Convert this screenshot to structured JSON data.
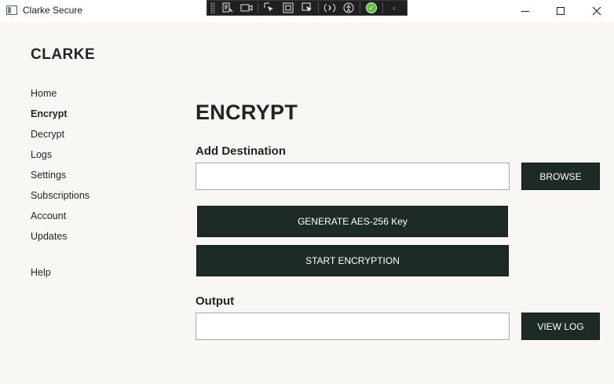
{
  "window": {
    "title": "Clarke Secure",
    "controls": [
      "minimize",
      "maximize",
      "close"
    ]
  },
  "devtools_bar": {
    "tools": [
      "live-visual-tree-icon",
      "record-icon",
      "select-element-icon",
      "display-layout-adorners-icon",
      "track-focus-icon",
      "hot-reload-icon",
      "accessibility-icon",
      "binding-ok-icon",
      "collapse-chevron-icon"
    ]
  },
  "sidebar": {
    "brand": "CLARKE",
    "items": [
      {
        "label": "Home"
      },
      {
        "label": "Encrypt"
      },
      {
        "label": "Decrypt"
      },
      {
        "label": "Logs"
      },
      {
        "label": "Settings"
      },
      {
        "label": "Subscriptions"
      },
      {
        "label": "Account"
      },
      {
        "label": "Updates"
      },
      {
        "label": "Help"
      }
    ],
    "active": "Encrypt"
  },
  "main": {
    "title": "ENCRYPT",
    "destination": {
      "label": "Add Destination",
      "value": "",
      "browse_label": "BROWSE"
    },
    "generate_key_label": "GENERATE AES-256 Key",
    "start_encryption_label": "START ENCRYPTION",
    "output": {
      "label": "Output",
      "value": "",
      "view_log_label": "VIEW LOG"
    }
  },
  "colors": {
    "background": "#f9f7f4",
    "button_dark": "#1d2a26",
    "text_dark": "#1d2622"
  }
}
